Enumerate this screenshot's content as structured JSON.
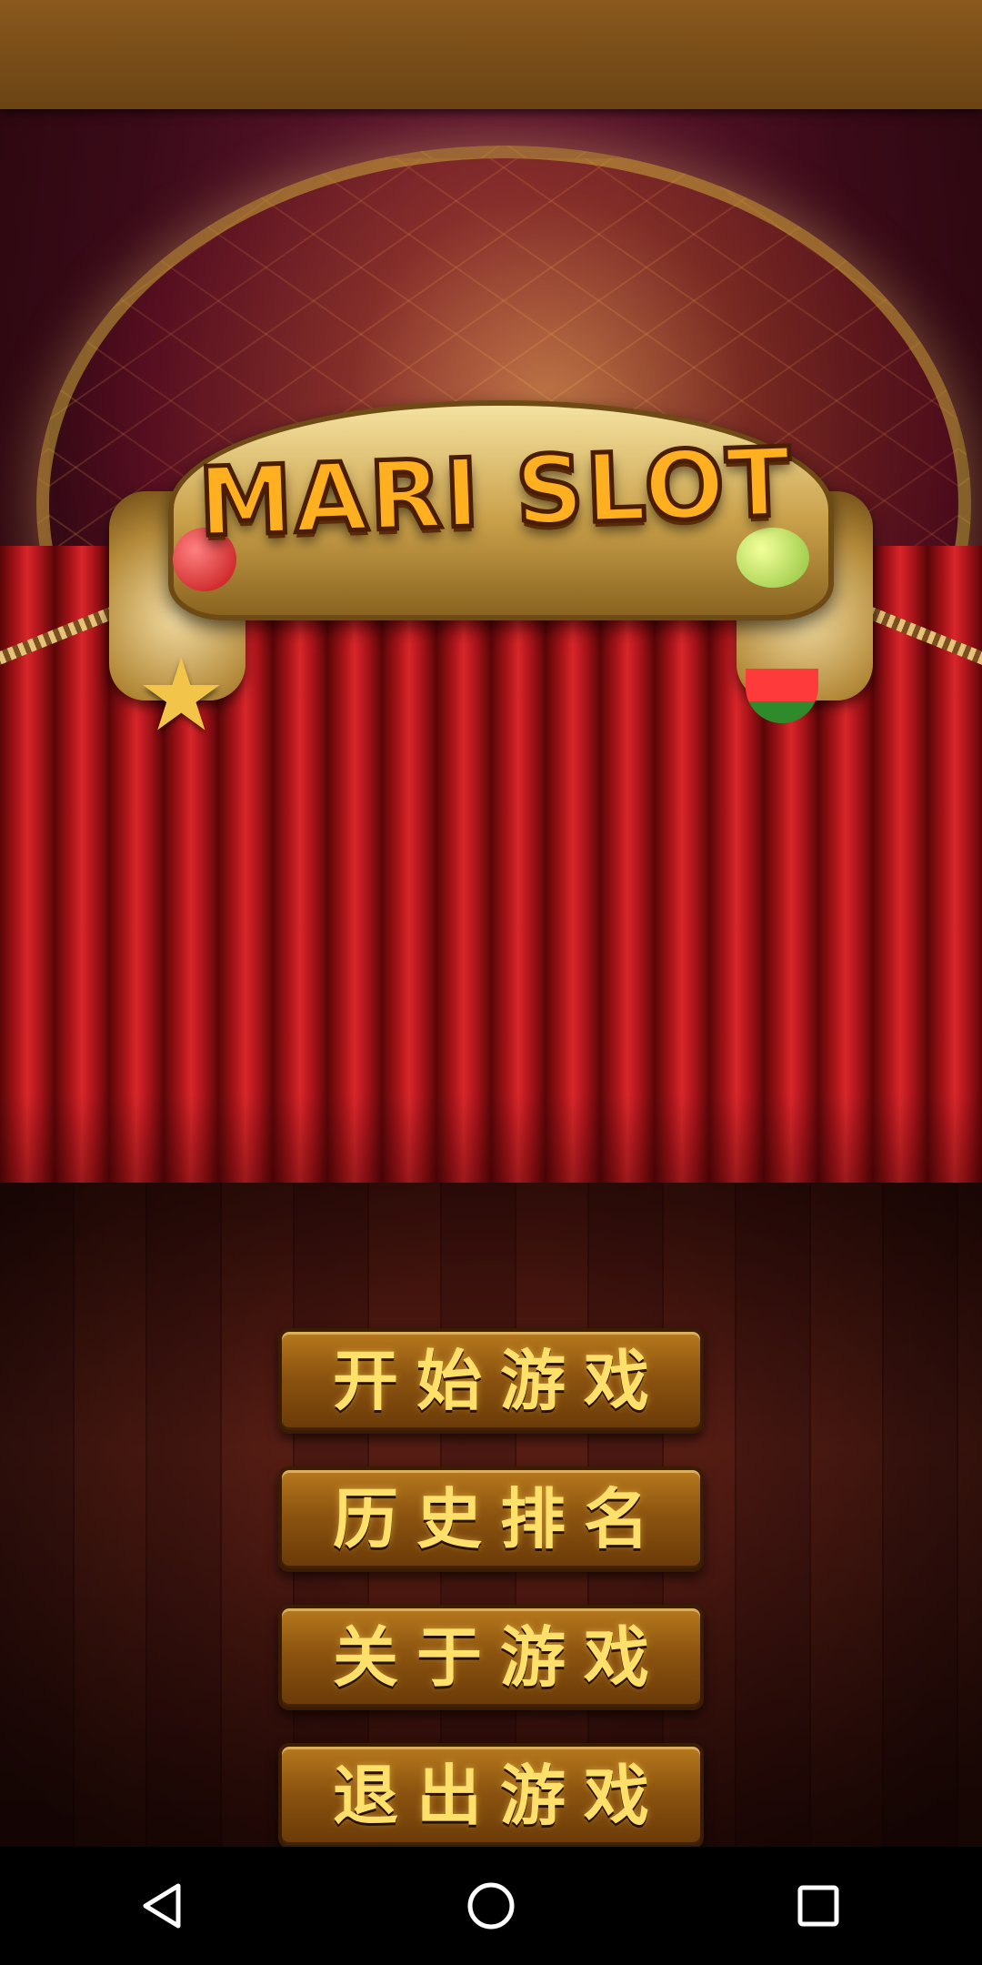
{
  "game": {
    "logo_text": "MARI SLOT"
  },
  "menu": {
    "items": [
      {
        "label": "开始游戏"
      },
      {
        "label": "历史排名"
      },
      {
        "label": "关于游戏"
      },
      {
        "label": "退出游戏"
      }
    ]
  },
  "system_nav": {
    "icons": [
      "back-icon",
      "home-icon",
      "recents-icon"
    ]
  },
  "colors": {
    "status_bar": "#7a4e1a",
    "curtain_red": "#c01a20",
    "button_gold": "#b87a1e",
    "button_text": "#ffe06a",
    "nav_bar": "#000000"
  }
}
